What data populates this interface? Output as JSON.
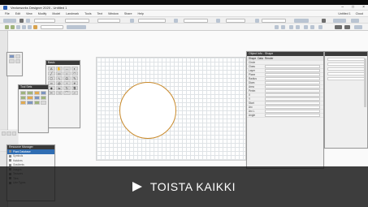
{
  "window": {
    "title": "Vectorworks Designer 2020 - Untitled 1"
  },
  "menubar": {
    "items": [
      "File",
      "Edit",
      "View",
      "Modify",
      "Model",
      "Landmark",
      "Tools",
      "Text",
      "Window",
      "Share",
      "Help"
    ],
    "right_items": [
      "Untitled 1",
      "Cloud"
    ]
  },
  "toolbar": {
    "zoom_value": "Fit to Window",
    "layer": "Layer-Plan",
    "class": "None"
  },
  "panels": {
    "basic_title": "Basic",
    "toolset_title": "Tool Sets",
    "resources_title": "Resource Manager",
    "resource_items": [
      "Plant Database",
      "Symbols",
      "Hatches",
      "Gradients",
      "Images",
      "Textures",
      "Tiles",
      "Line Types"
    ],
    "selected_resource_index": 0
  },
  "object_info": {
    "title": "Object Info - Shape",
    "tabs": [
      "Shape",
      "Data",
      "Render"
    ],
    "object_type": "Circle",
    "properties": [
      {
        "key": "Class"
      },
      {
        "key": "Layer"
      },
      {
        "key": "Plane"
      },
      {
        "key": "Radius"
      },
      {
        "key": "Diam"
      },
      {
        "key": "Area"
      },
      {
        "key": "Perim"
      },
      {
        "key": "X"
      },
      {
        "key": "Y"
      },
      {
        "key": "Start"
      },
      {
        "key": "Arc"
      },
      {
        "key": "Arc L"
      },
      {
        "key": "Angle"
      }
    ]
  },
  "overlay": {
    "play_label": "TOISTA KAIKKI"
  },
  "colors": {
    "accent": "#2f6db3",
    "circle_stroke": "#c98a2b"
  }
}
